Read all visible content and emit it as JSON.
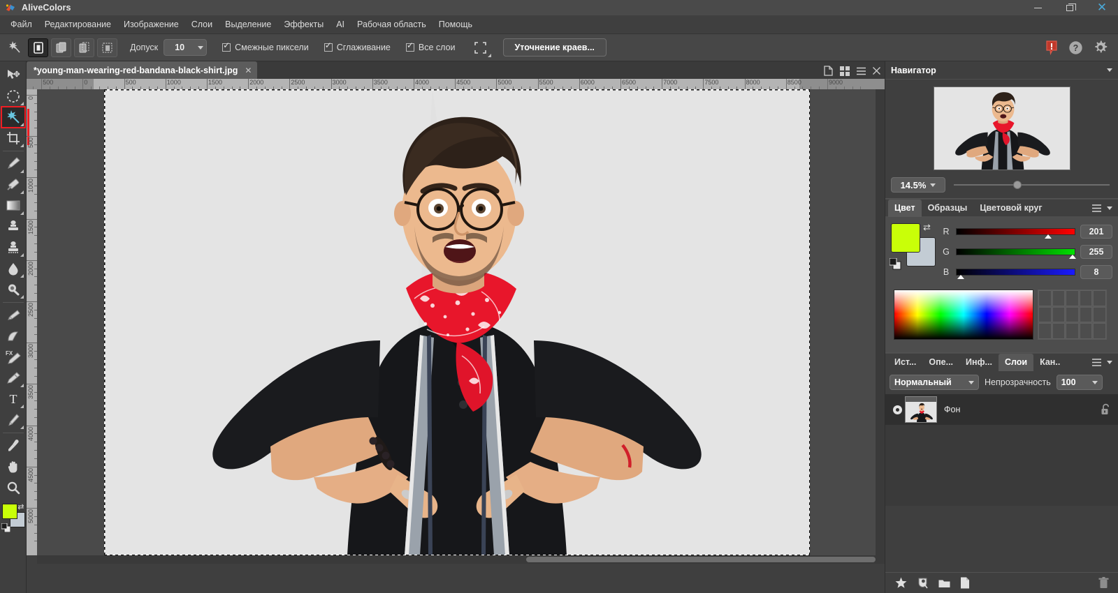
{
  "app": {
    "title": "AliveColors",
    "logo_icon": "alivecolors-logo-icon"
  },
  "window_controls": {
    "minimize": "minimize-icon",
    "maximize": "restore-icon",
    "close": "close-icon"
  },
  "menubar": {
    "items": [
      {
        "label": "Файл"
      },
      {
        "label": "Редактирование"
      },
      {
        "label": "Изображение"
      },
      {
        "label": "Слои"
      },
      {
        "label": "Выделение"
      },
      {
        "label": "Эффекты"
      },
      {
        "label": "AI"
      },
      {
        "label": "Рабочая область"
      },
      {
        "label": "Помощь"
      }
    ]
  },
  "options_bar": {
    "active_tool_icon": "magic-wand-icon",
    "selection_modes": [
      {
        "name": "new-selection",
        "active": true
      },
      {
        "name": "add-to-selection",
        "active": false
      },
      {
        "name": "subtract-from-selection",
        "active": false
      },
      {
        "name": "intersect-selection",
        "active": false
      }
    ],
    "tolerance_label": "Допуск",
    "tolerance_value": "10",
    "checkboxes": [
      {
        "label": "Смежные пиксели",
        "checked": true
      },
      {
        "label": "Сглаживание",
        "checked": true
      },
      {
        "label": "Все слои",
        "checked": true
      }
    ],
    "quick_mask_icon": "quick-mask-icon",
    "refine_edges_button": "Уточнение краев...",
    "right_icons": [
      {
        "name": "notification-alert-icon"
      },
      {
        "name": "help-icon"
      },
      {
        "name": "settings-gear-icon"
      }
    ]
  },
  "left_toolbar": {
    "tools": [
      {
        "name": "move-tool",
        "icon": "move-arrow-icon",
        "selected": false,
        "has_submenu": false
      },
      {
        "name": "elliptical-marquee-tool",
        "icon": "ellipse-select-icon",
        "selected": false,
        "has_submenu": true
      },
      {
        "name": "magic-wand-tool",
        "icon": "magic-wand-icon",
        "selected": true,
        "has_submenu": true
      },
      {
        "name": "crop-tool",
        "icon": "crop-icon",
        "selected": false,
        "has_submenu": true
      },
      {
        "name": "brush-tool",
        "icon": "paintbrush-icon",
        "selected": false,
        "has_submenu": true
      },
      {
        "name": "eraser-tool",
        "icon": "eraser-icon",
        "selected": false,
        "has_submenu": true
      },
      {
        "name": "gradient-tool",
        "icon": "gradient-icon",
        "selected": false,
        "has_submenu": true
      },
      {
        "name": "clone-stamp-tool",
        "icon": "stamp-icon",
        "selected": false,
        "has_submenu": false
      },
      {
        "name": "pattern-stamp-tool",
        "icon": "pattern-stamp-icon",
        "selected": false,
        "has_submenu": true
      },
      {
        "name": "blur-tool",
        "icon": "water-drop-icon",
        "selected": false,
        "has_submenu": true
      },
      {
        "name": "dodge-tool",
        "icon": "dodge-burn-icon",
        "selected": false,
        "has_submenu": true
      },
      {
        "name": "smudge-tool",
        "icon": "smudge-finger-icon",
        "selected": false,
        "has_submenu": true
      },
      {
        "name": "history-brush-tool",
        "icon": "history-brush-icon",
        "selected": false,
        "has_submenu": false
      },
      {
        "name": "fx-brush-tool",
        "icon": "fx-brush-icon",
        "selected": false,
        "has_submenu": false
      },
      {
        "name": "marker-tool",
        "icon": "marker-icon",
        "selected": false,
        "has_submenu": true
      },
      {
        "name": "text-tool",
        "icon": "text-t-icon",
        "selected": false,
        "has_submenu": true
      },
      {
        "name": "pen-tool",
        "icon": "pen-nib-icon",
        "selected": false,
        "has_submenu": true
      },
      {
        "name": "eyedropper-tool",
        "icon": "eyedropper-icon",
        "selected": false,
        "has_submenu": false
      },
      {
        "name": "hand-tool",
        "icon": "hand-icon",
        "selected": false,
        "has_submenu": false
      },
      {
        "name": "zoom-tool",
        "icon": "magnifier-icon",
        "selected": false,
        "has_submenu": false
      }
    ],
    "foreground_color": "#c9ff08",
    "background_color": "#c3ccd4",
    "swap_icon": "swap-colors-icon",
    "default_colors_icon": "default-colors-icon"
  },
  "document_tabs": {
    "tabs": [
      {
        "label": "*young-man-wearing-red-bandana-black-shirt.jpg",
        "close_icon": "close-tab-icon",
        "active": true
      }
    ],
    "right_icons": [
      {
        "name": "new-document-icon"
      },
      {
        "name": "tile-view-icon"
      },
      {
        "name": "panel-menu-icon"
      },
      {
        "name": "panel-close-icon"
      }
    ]
  },
  "rulers": {
    "horizontal_ticks": [
      "0",
      "500",
      "0",
      "500",
      "1000",
      "1500",
      "2000",
      "2500",
      "3000",
      "3500",
      "4000",
      "4500",
      "5000",
      "5500",
      "6000",
      "6500",
      "7000",
      "7500",
      "8000",
      "8500",
      "9000"
    ],
    "vertical_ticks": [
      "0",
      "500",
      "1000",
      "1500",
      "2000",
      "2500",
      "3000",
      "3500",
      "4000",
      "4500",
      "5000"
    ]
  },
  "canvas": {
    "background_color": "#e4e4e4",
    "selection_active": true,
    "image_alt": "young man wearing red bandana and black shirt pointing at himself"
  },
  "navigator": {
    "title": "Навигатор",
    "collapse_icon": "chevron-down-icon",
    "zoom_value": "14.5%",
    "zoom_dropdown_icon": "chevron-down-icon"
  },
  "color_panel": {
    "tabs": [
      {
        "label": "Цвет",
        "active": true
      },
      {
        "label": "Образцы",
        "active": false
      },
      {
        "label": "Цветовой круг",
        "active": false
      }
    ],
    "menu_icon": "hamburger-menu-icon",
    "collapse_icon": "chevron-down-icon",
    "foreground_color": "#c9ff08",
    "background_color": "#c3ccd4",
    "swap_icon": "swap-colors-icon",
    "channels": [
      {
        "label": "R",
        "value": "201",
        "percent": 78.8
      },
      {
        "label": "G",
        "value": "255",
        "percent": 100
      },
      {
        "label": "B",
        "value": "8",
        "percent": 3.1
      }
    ]
  },
  "layers_panel": {
    "tabs": [
      {
        "label": "Ист...",
        "active": false
      },
      {
        "label": "Опе...",
        "active": false
      },
      {
        "label": "Инф...",
        "active": false
      },
      {
        "label": "Слои",
        "active": true
      },
      {
        "label": "Кан..",
        "active": false
      }
    ],
    "menu_icon": "hamburger-menu-icon",
    "collapse_icon": "chevron-down-icon",
    "blend_mode": "Нормальный",
    "blend_dropdown_icon": "chevron-down-icon",
    "opacity_label": "Непрозрачность",
    "opacity_value": "100",
    "opacity_dropdown_icon": "chevron-down-icon",
    "layers": [
      {
        "name": "Фон",
        "visible": true,
        "locked": true,
        "visibility_icon": "eye-icon",
        "lock_icon": "unlocked-padlock-icon"
      }
    ],
    "footer_icons": [
      {
        "name": "new-effect-layer-icon"
      },
      {
        "name": "adjustment-layer-icon"
      },
      {
        "name": "new-group-icon"
      },
      {
        "name": "new-layer-icon"
      },
      {
        "name": "delete-layer-icon"
      }
    ]
  }
}
